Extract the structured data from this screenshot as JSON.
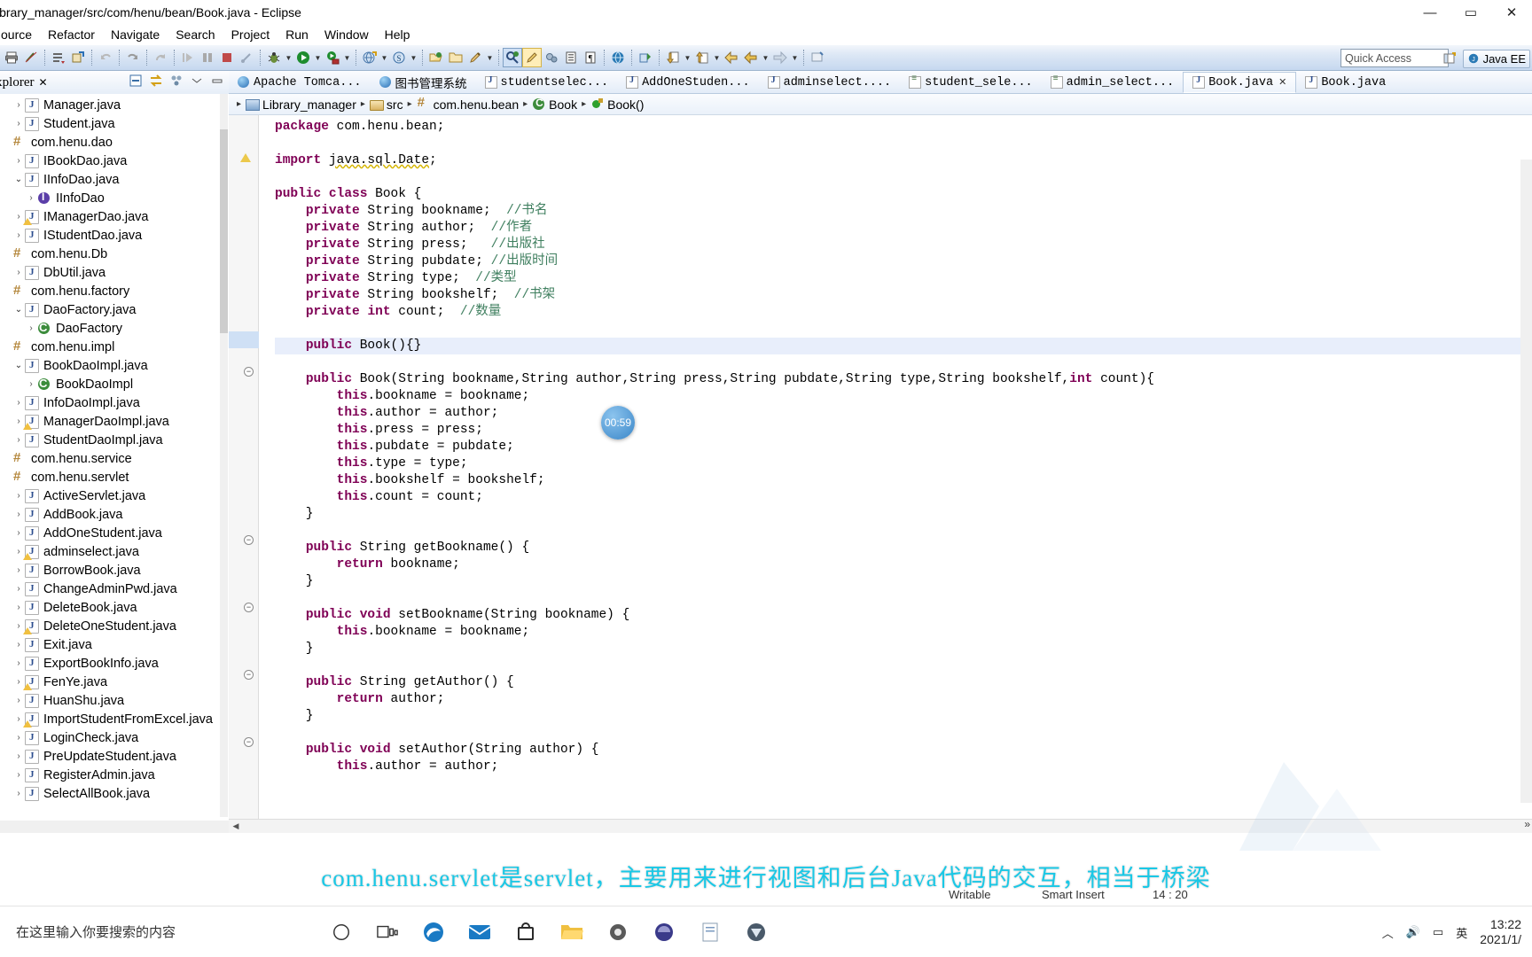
{
  "window": {
    "title": "ibrary_manager/src/com/henu/bean/Book.java - Eclipse",
    "minimize": "—",
    "maximize": "▭",
    "close": "✕"
  },
  "menu": {
    "items": [
      "ource",
      "Refactor",
      "Navigate",
      "Search",
      "Project",
      "Run",
      "Window",
      "Help"
    ]
  },
  "toolbar": {
    "quick_access_placeholder": "Quick Access",
    "perspective_label": "Java EE",
    "buttons": [
      {
        "name": "print-icon",
        "glyph": "🖶"
      },
      {
        "name": "toggle-mark-occurrences-icon",
        "glyph": "✎"
      },
      {
        "name": "new-java-class-icon",
        "glyph": "≡"
      },
      {
        "name": "new-element-icon",
        "glyph": "✦"
      },
      {
        "name": "save-icon",
        "glyph": "↷"
      },
      {
        "name": "undo-icon",
        "glyph": "↶"
      },
      {
        "name": "redo-icon",
        "glyph": "↷"
      },
      {
        "name": "resume-icon",
        "glyph": "▶"
      },
      {
        "name": "suspend-icon",
        "glyph": "❚❚"
      },
      {
        "name": "terminate-icon",
        "glyph": "■"
      },
      {
        "name": "step-icon",
        "glyph": "⤵"
      },
      {
        "name": "debug-icon",
        "glyph": "🐞"
      },
      {
        "name": "run-icon",
        "glyph": "▶"
      },
      {
        "name": "run-server-icon",
        "glyph": "▸"
      },
      {
        "name": "new-server-icon",
        "glyph": "▤"
      },
      {
        "name": "external-tools-icon",
        "glyph": "S"
      },
      {
        "name": "open-type-icon",
        "glyph": "📂"
      },
      {
        "name": "open-task-icon",
        "glyph": "📁"
      },
      {
        "name": "annotation-icon",
        "glyph": "✏"
      },
      {
        "name": "search-java-icon",
        "glyph": "🔎"
      },
      {
        "name": "pencil-icon",
        "glyph": "✏"
      },
      {
        "name": "link-icon",
        "glyph": "⚙"
      },
      {
        "name": "outline-icon",
        "glyph": "▤"
      },
      {
        "name": "format-icon",
        "glyph": "¶"
      },
      {
        "name": "web-browser-icon",
        "glyph": "🌐"
      },
      {
        "name": "profile-icon",
        "glyph": "⇪"
      },
      {
        "name": "next-annotation-icon",
        "glyph": "⬇"
      },
      {
        "name": "previous-annotation-icon",
        "glyph": "⬆"
      },
      {
        "name": "back-history-icon",
        "glyph": "⬅"
      },
      {
        "name": "forward-history-icon",
        "glyph": "⬅"
      },
      {
        "name": "forward-icon",
        "glyph": "➡"
      },
      {
        "name": "pin-editor-icon",
        "glyph": "🗔"
      }
    ]
  },
  "explorer": {
    "tab_label": "Explorer",
    "tab_close": "✕",
    "tools": [
      {
        "name": "collapse-all-icon",
        "glyph": "⊟"
      },
      {
        "name": "link-with-editor-icon",
        "glyph": "⇄"
      },
      {
        "name": "view-menu-icon",
        "glyph": "❖"
      },
      {
        "name": "minimize-view-icon",
        "glyph": "▽"
      },
      {
        "name": "maximize-view-icon",
        "glyph": "▭"
      }
    ],
    "tree": [
      {
        "indent": 1,
        "arrow": "closed",
        "icon": "java",
        "label": "Manager.java"
      },
      {
        "indent": 1,
        "arrow": "closed",
        "icon": "java",
        "label": "Student.java"
      },
      {
        "indent": 0,
        "arrow": "none",
        "icon": "pkg",
        "label": "com.henu.dao"
      },
      {
        "indent": 1,
        "arrow": "closed",
        "icon": "java",
        "label": "IBookDao.java"
      },
      {
        "indent": 1,
        "arrow": "open",
        "icon": "java",
        "label": "IInfoDao.java"
      },
      {
        "indent": 2,
        "arrow": "closed",
        "icon": "iface",
        "label": "IInfoDao"
      },
      {
        "indent": 1,
        "arrow": "closed",
        "icon": "java-warn",
        "label": "IManagerDao.java"
      },
      {
        "indent": 1,
        "arrow": "closed",
        "icon": "java",
        "label": "IStudentDao.java"
      },
      {
        "indent": 0,
        "arrow": "none",
        "icon": "pkg",
        "label": "com.henu.Db"
      },
      {
        "indent": 1,
        "arrow": "closed",
        "icon": "java",
        "label": "DbUtil.java"
      },
      {
        "indent": 0,
        "arrow": "none",
        "icon": "pkg",
        "label": "com.henu.factory"
      },
      {
        "indent": 1,
        "arrow": "open",
        "icon": "java",
        "label": "DaoFactory.java"
      },
      {
        "indent": 2,
        "arrow": "closed",
        "icon": "class",
        "label": "DaoFactory"
      },
      {
        "indent": 0,
        "arrow": "none",
        "icon": "pkg",
        "label": "com.henu.impl"
      },
      {
        "indent": 1,
        "arrow": "open",
        "icon": "java",
        "label": "BookDaoImpl.java"
      },
      {
        "indent": 2,
        "arrow": "closed",
        "icon": "class",
        "label": "BookDaoImpl"
      },
      {
        "indent": 1,
        "arrow": "closed",
        "icon": "java",
        "label": "InfoDaoImpl.java"
      },
      {
        "indent": 1,
        "arrow": "closed",
        "icon": "java-warn",
        "label": "ManagerDaoImpl.java"
      },
      {
        "indent": 1,
        "arrow": "closed",
        "icon": "java",
        "label": "StudentDaoImpl.java"
      },
      {
        "indent": 0,
        "arrow": "none",
        "icon": "pkg",
        "label": "com.henu.service"
      },
      {
        "indent": 0,
        "arrow": "none",
        "icon": "pkg",
        "label": "com.henu.servlet"
      },
      {
        "indent": 1,
        "arrow": "closed",
        "icon": "java",
        "label": "ActiveServlet.java"
      },
      {
        "indent": 1,
        "arrow": "closed",
        "icon": "java",
        "label": "AddBook.java"
      },
      {
        "indent": 1,
        "arrow": "closed",
        "icon": "java",
        "label": "AddOneStudent.java"
      },
      {
        "indent": 1,
        "arrow": "closed",
        "icon": "java-warn",
        "label": "adminselect.java"
      },
      {
        "indent": 1,
        "arrow": "closed",
        "icon": "java",
        "label": "BorrowBook.java"
      },
      {
        "indent": 1,
        "arrow": "closed",
        "icon": "java",
        "label": "ChangeAdminPwd.java"
      },
      {
        "indent": 1,
        "arrow": "closed",
        "icon": "java",
        "label": "DeleteBook.java"
      },
      {
        "indent": 1,
        "arrow": "closed",
        "icon": "java-warn",
        "label": "DeleteOneStudent.java"
      },
      {
        "indent": 1,
        "arrow": "closed",
        "icon": "java",
        "label": "Exit.java"
      },
      {
        "indent": 1,
        "arrow": "closed",
        "icon": "java",
        "label": "ExportBookInfo.java"
      },
      {
        "indent": 1,
        "arrow": "closed",
        "icon": "java-warn",
        "label": "FenYe.java"
      },
      {
        "indent": 1,
        "arrow": "closed",
        "icon": "java",
        "label": "HuanShu.java"
      },
      {
        "indent": 1,
        "arrow": "closed",
        "icon": "java-warn",
        "label": "ImportStudentFromExcel.java"
      },
      {
        "indent": 1,
        "arrow": "closed",
        "icon": "java",
        "label": "LoginCheck.java"
      },
      {
        "indent": 1,
        "arrow": "closed",
        "icon": "java",
        "label": "PreUpdateStudent.java"
      },
      {
        "indent": 1,
        "arrow": "closed",
        "icon": "java",
        "label": "RegisterAdmin.java"
      },
      {
        "indent": 1,
        "arrow": "closed",
        "icon": "java",
        "label": "SelectAllBook.java"
      }
    ]
  },
  "editor": {
    "tabs": [
      {
        "label": "Apache Tomca...",
        "icon": "web",
        "active": false,
        "closable": false
      },
      {
        "label": "图书管理系统",
        "icon": "web",
        "active": false,
        "closable": false
      },
      {
        "label": "studentselec...",
        "icon": "java",
        "active": false,
        "closable": false
      },
      {
        "label": "AddOneStuden...",
        "icon": "java",
        "active": false,
        "closable": false
      },
      {
        "label": "adminselect....",
        "icon": "java",
        "active": false,
        "closable": false
      },
      {
        "label": "student_sele...",
        "icon": "doc",
        "active": false,
        "closable": false
      },
      {
        "label": "admin_select...",
        "icon": "doc",
        "active": false,
        "closable": false
      },
      {
        "label": "Book.java",
        "icon": "java",
        "active": true,
        "closable": true,
        "close": "✕"
      },
      {
        "label": "Book.java",
        "icon": "java",
        "active": false,
        "closable": false
      }
    ],
    "tab_overflow": "»",
    "breadcrumb": [
      {
        "icon": "proj",
        "label": "Library_manager"
      },
      {
        "icon": "src",
        "label": "src"
      },
      {
        "icon": "pkg",
        "label": "com.henu.bean"
      },
      {
        "icon": "class",
        "label": "Book"
      },
      {
        "icon": "method",
        "label": "Book()"
      }
    ],
    "timer_bubble": "00:59",
    "code_lines": [
      {
        "t": "kw",
        "s": "package "
      },
      {
        "t": "p",
        "s": "com.henu.bean;"
      },
      {
        "t": "nl"
      },
      {
        "t": "nl"
      },
      {
        "t": "kw",
        "s": "import "
      },
      {
        "t": "imp",
        "s": "java.sql.Date"
      },
      {
        "t": "p",
        "s": ";"
      },
      {
        "t": "nl"
      },
      {
        "t": "nl"
      },
      {
        "t": "kw",
        "s": "public class "
      },
      {
        "t": "p",
        "s": "Book {"
      },
      {
        "t": "nl"
      },
      {
        "t": "p",
        "s": "    "
      },
      {
        "t": "kw",
        "s": "private "
      },
      {
        "t": "p",
        "s": "String bookname;  "
      },
      {
        "t": "cm",
        "s": "//书名"
      },
      {
        "t": "nl"
      },
      {
        "t": "p",
        "s": "    "
      },
      {
        "t": "kw",
        "s": "private "
      },
      {
        "t": "p",
        "s": "String author;  "
      },
      {
        "t": "cm",
        "s": "//作者"
      },
      {
        "t": "nl"
      },
      {
        "t": "p",
        "s": "    "
      },
      {
        "t": "kw",
        "s": "private "
      },
      {
        "t": "p",
        "s": "String press;   "
      },
      {
        "t": "cm",
        "s": "//出版社"
      },
      {
        "t": "nl"
      },
      {
        "t": "p",
        "s": "    "
      },
      {
        "t": "kw",
        "s": "private "
      },
      {
        "t": "p",
        "s": "String pubdate; "
      },
      {
        "t": "cm",
        "s": "//出版时间"
      },
      {
        "t": "nl"
      },
      {
        "t": "p",
        "s": "    "
      },
      {
        "t": "kw",
        "s": "private "
      },
      {
        "t": "p",
        "s": "String type;  "
      },
      {
        "t": "cm",
        "s": "//类型"
      },
      {
        "t": "nl"
      },
      {
        "t": "p",
        "s": "    "
      },
      {
        "t": "kw",
        "s": "private "
      },
      {
        "t": "p",
        "s": "String bookshelf;  "
      },
      {
        "t": "cm",
        "s": "//书架"
      },
      {
        "t": "nl"
      },
      {
        "t": "p",
        "s": "    "
      },
      {
        "t": "kw",
        "s": "private "
      },
      {
        "t": "kw",
        "s": "int "
      },
      {
        "t": "p",
        "s": "count;  "
      },
      {
        "t": "cm",
        "s": "//数量"
      },
      {
        "t": "nl"
      },
      {
        "t": "nl"
      }
    ],
    "code_text": "package com.henu.bean;\n\nimport java.sql.Date;\n\npublic class Book {\n    private String bookname;  //书名\n    private String author;  //作者\n    private String press;   //出版社\n    private String pubdate; //出版时间\n    private String type;  //类型\n    private String bookshelf;  //书架\n    private int count;  //数量\n\n    public Book(){}\n\n    public Book(String bookname,String author,String press,String pubdate,String type,String bookshelf,int count){\n        this.bookname = bookname;\n        this.author = author;\n        this.press = press;\n        this.pubdate = pubdate;\n        this.type = type;\n        this.bookshelf = bookshelf;\n        this.count = count;\n    }\n\n    public String getBookname() {\n        return bookname;\n    }\n\n    public void setBookname(String bookname) {\n        this.bookname = bookname;\n    }\n\n    public String getAuthor() {\n        return author;\n    }\n\n    public void setAuthor(String author) {\n        this.author = author;"
  },
  "statusbar": {
    "writable": "Writable",
    "insert_mode": "Smart Insert",
    "position": "14 : 20"
  },
  "caption": {
    "text": "com.henu.servlet是servlet，主要用来进行视图和后台Java代码的交互，相当于桥梁",
    "color": "#19c8e6"
  },
  "taskbar": {
    "search_placeholder": "在这里输入你要搜索的内容",
    "icons": [
      {
        "name": "cortana-icon",
        "glyph": "◯"
      },
      {
        "name": "task-view-icon",
        "glyph": "❐"
      },
      {
        "name": "edge-icon",
        "glyph": "e"
      },
      {
        "name": "mail-icon",
        "glyph": "✉"
      },
      {
        "name": "store-icon",
        "glyph": "🛍"
      },
      {
        "name": "file-explorer-icon",
        "glyph": "📁"
      },
      {
        "name": "settings-icon",
        "glyph": "⚙"
      },
      {
        "name": "eclipse-icon",
        "glyph": "◐"
      },
      {
        "name": "notepad-icon",
        "glyph": "📝"
      },
      {
        "name": "app-icon",
        "glyph": "◆"
      }
    ],
    "tray": [
      {
        "name": "show-hidden-icons",
        "glyph": "︿"
      },
      {
        "name": "volume-icon",
        "glyph": "🔊"
      },
      {
        "name": "network-icon",
        "glyph": "▭"
      },
      {
        "name": "ime-indicator",
        "glyph": "英"
      }
    ],
    "clock_time": "13:22",
    "clock_date": "2021/1/"
  }
}
